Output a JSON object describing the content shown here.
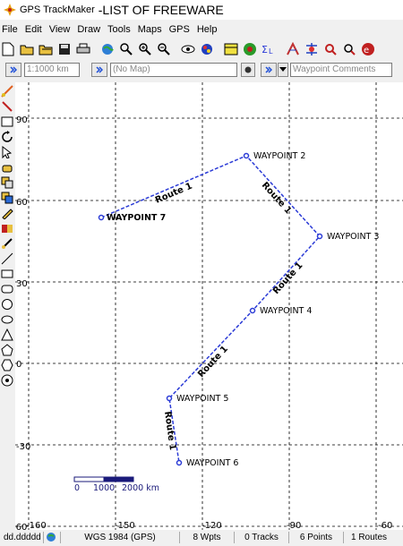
{
  "window": {
    "app_name": "GPS TrackMaker",
    "document_name": "-LIST OF FREEWARE"
  },
  "menu": [
    "File",
    "Edit",
    "View",
    "Draw",
    "Tools",
    "Maps",
    "GPS",
    "Help"
  ],
  "scale": {
    "value": "1:1000 km",
    "map": "(No Map)",
    "comments_placeholder": "Waypoint Comments"
  },
  "axes": {
    "lat_labels": [
      "90",
      "60",
      "30",
      "0",
      "-30",
      "-60"
    ],
    "lon_labels": [
      "-160",
      "-150",
      "-120",
      "-90",
      "-60"
    ]
  },
  "waypoints": [
    "WAYPOINT 7",
    "WAYPOINT 2",
    "WAYPOINT 3",
    "WAYPOINT 4",
    "WAYPOINT 5",
    "WAYPOINT 6"
  ],
  "routes": {
    "label": "Route 1"
  },
  "scalebar": {
    "labels": [
      "0",
      "1000",
      "2000 km"
    ]
  },
  "status": {
    "coords": "dd.ddddd",
    "datum": "WGS 1984 (GPS)",
    "wpts": "8 Wpts",
    "tracks": "0 Tracks",
    "points": "6 Points",
    "routes": "1 Routes"
  },
  "colors": {
    "route_line": "#2b3bd6",
    "grid": "#000000"
  }
}
